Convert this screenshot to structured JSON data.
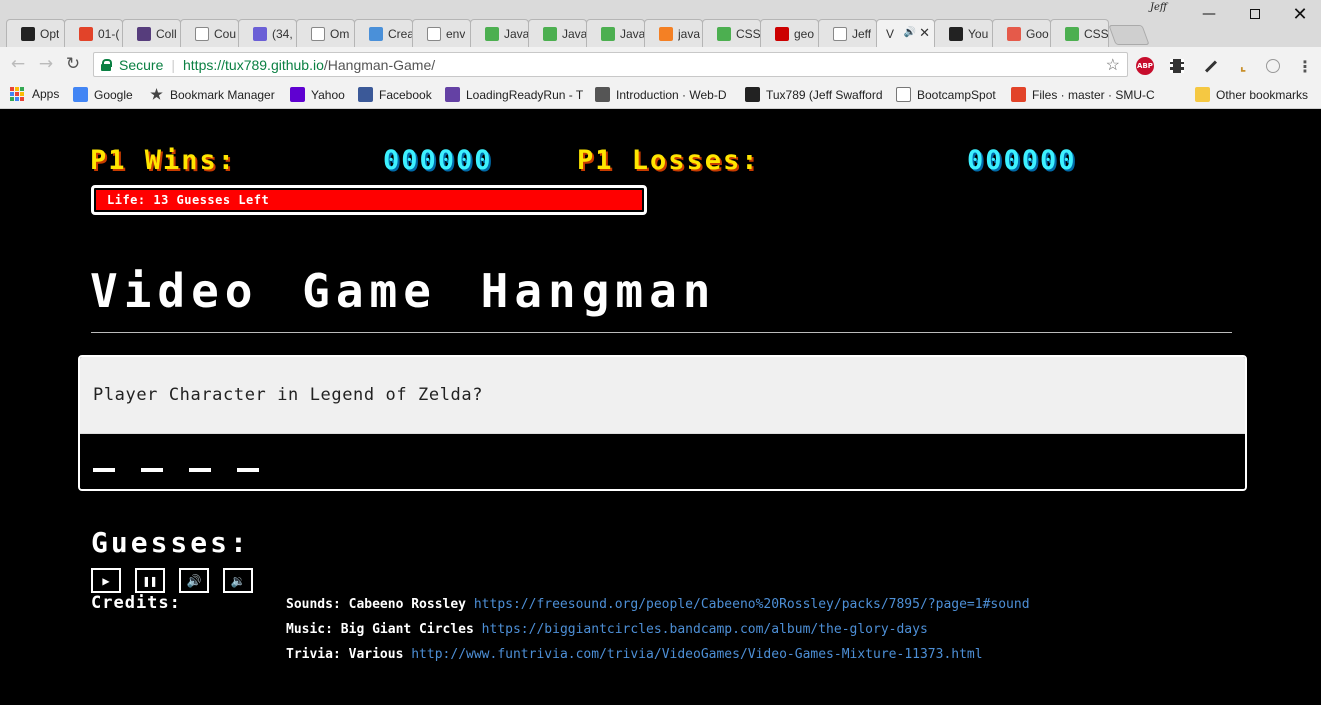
{
  "browser": {
    "profile_name": "Jeff",
    "tabs": [
      {
        "title": "Opt",
        "icon": "github-icon",
        "color": "#222222"
      },
      {
        "title": "01-(",
        "icon": "gitlab-icon",
        "color": "#e24329"
      },
      {
        "title": "Coll",
        "icon": "bootstrap-icon",
        "color": "#563d7c"
      },
      {
        "title": "Cou",
        "icon": "page-icon",
        "color": "#ffffff"
      },
      {
        "title": "(34,",
        "icon": "mail-icon",
        "color": "#6b5fd6"
      },
      {
        "title": "Om",
        "icon": "page-icon",
        "color": "#ffffff"
      },
      {
        "title": "Crea",
        "icon": "window-icon",
        "color": "#4a90d9"
      },
      {
        "title": "env",
        "icon": "page-icon",
        "color": "#ffffff"
      },
      {
        "title": "Java",
        "icon": "w3schools-icon",
        "color": "#4caf50"
      },
      {
        "title": "Java",
        "icon": "w3schools-icon",
        "color": "#4caf50"
      },
      {
        "title": "Java",
        "icon": "w3schools-icon",
        "color": "#4caf50"
      },
      {
        "title": "java",
        "icon": "stackoverflow-icon",
        "color": "#f48024"
      },
      {
        "title": "CSS",
        "icon": "w3schools-icon",
        "color": "#4caf50"
      },
      {
        "title": "geo",
        "icon": "n-icon",
        "color": "#cc0000"
      },
      {
        "title": "Jeff",
        "icon": "page-icon",
        "color": "#ffffff"
      },
      {
        "title": "V",
        "icon": "none",
        "color": "#f2f2f2",
        "active": true
      },
      {
        "title": "You",
        "icon": "github-icon",
        "color": "#222222"
      },
      {
        "title": "Goo",
        "icon": "f-icon",
        "color": "#e55a4a"
      },
      {
        "title": "CSS",
        "icon": "w3schools-icon",
        "color": "#4caf50"
      }
    ],
    "url": {
      "secure_label": "Secure",
      "scheme_host": "https://tux789.github.io",
      "path": "/Hangman-Game/"
    },
    "bookmarks": [
      {
        "label": "Apps",
        "icon": "apps-icon"
      },
      {
        "label": "Google",
        "icon": "google-icon"
      },
      {
        "label": "Bookmark Manager",
        "icon": "star-icon"
      },
      {
        "label": "Yahoo",
        "icon": "yahoo-icon"
      },
      {
        "label": "Facebook",
        "icon": "facebook-icon"
      },
      {
        "label": "LoadingReadyRun - T",
        "icon": "twitch-icon"
      },
      {
        "label": "Introduction · Web-D",
        "icon": "book-icon"
      },
      {
        "label": "Tux789 (Jeff Swafford",
        "icon": "github-icon"
      },
      {
        "label": "BootcampSpot",
        "icon": "page-icon"
      },
      {
        "label": "Files · master · SMU-C",
        "icon": "gitlab-icon"
      },
      {
        "label": "Other bookmarks",
        "icon": "folder-icon"
      }
    ]
  },
  "game": {
    "wins_label": "P1 Wins:",
    "wins_value": "000000",
    "losses_label": "P1 Losses:",
    "losses_value": "000000",
    "life_text": "Life: 13 Guesses Left",
    "life_fraction": 1.0,
    "title": "Video Game Hangman",
    "question": "Player Character in Legend of Zelda?",
    "blanks_count": 4,
    "guesses_label": "Guesses:",
    "guessed_letters": "",
    "controls": [
      {
        "name": "play-button",
        "glyph": "▶"
      },
      {
        "name": "pause-button",
        "glyph": "❚❚"
      },
      {
        "name": "volume-up-button",
        "glyph": "🔊"
      },
      {
        "name": "volume-down-button",
        "glyph": "🔉"
      }
    ],
    "credits_label": "Credits:",
    "credits": [
      {
        "label": "Sounds: Cabeeno Rossley",
        "link": "https://freesound.org/people/Cabeeno%20Rossley/packs/7895/?page=1#sound"
      },
      {
        "label": "Music: Big Giant Circles",
        "link": "https://biggiantcircles.bandcamp.com/album/the-glory-days"
      },
      {
        "label": "Trivia: Various",
        "link": "http://www.funtrivia.com/trivia/VideoGames/Video-Games-Mixture-11373.html"
      }
    ]
  }
}
